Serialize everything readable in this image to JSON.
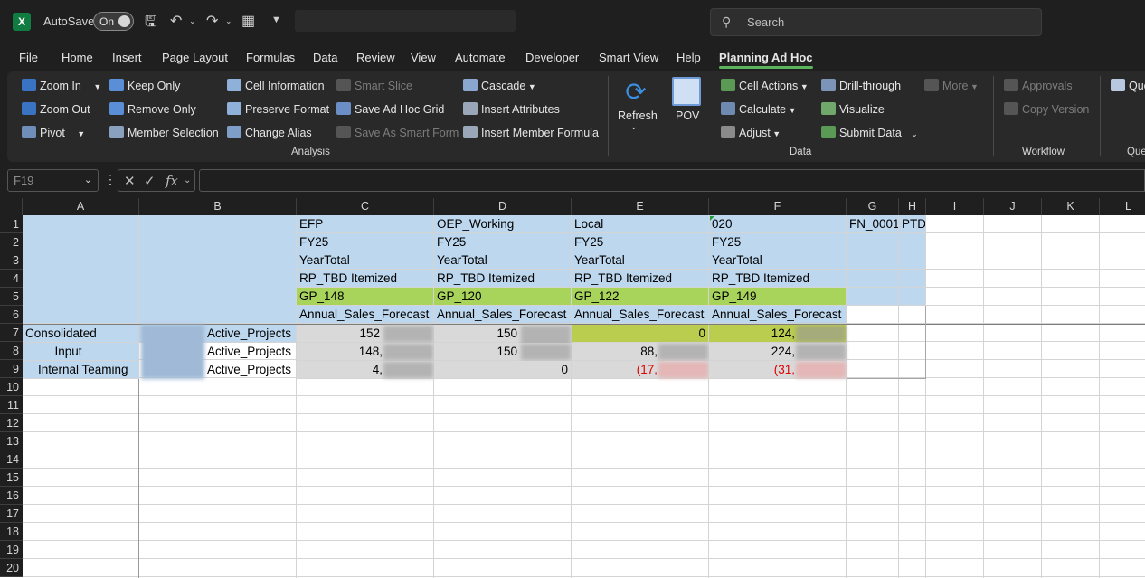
{
  "titlebar": {
    "app_icon": "excel-icon",
    "app_letter": "X",
    "autosave_label": "AutoSave",
    "autosave_state": "On",
    "search_placeholder": "Search"
  },
  "menu": [
    "File",
    "Home",
    "Insert",
    "Page Layout",
    "Formulas",
    "Data",
    "Review",
    "View",
    "Automate",
    "Developer",
    "Smart View",
    "Help",
    "Planning Ad Hoc"
  ],
  "menu_active": "Planning Ad Hoc",
  "ribbon": {
    "analysis": {
      "zoom_in": "Zoom In",
      "zoom_out": "Zoom Out",
      "pivot": "Pivot",
      "keep_only": "Keep Only",
      "remove_only": "Remove Only",
      "member_selection": "Member Selection",
      "cell_information": "Cell Information",
      "preserve_format": "Preserve Format",
      "change_alias": "Change Alias",
      "smart_slice": "Smart Slice",
      "save_ad_hoc_grid": "Save Ad Hoc Grid",
      "save_as_smart_form": "Save As Smart Form",
      "cascade": "Cascade",
      "insert_attributes": "Insert Attributes",
      "insert_member_formula": "Insert Member Formula",
      "label": "Analysis"
    },
    "refresh": "Refresh",
    "pov": "POV",
    "data": {
      "cell_actions": "Cell Actions",
      "calculate": "Calculate",
      "adjust": "Adjust",
      "drill_through": "Drill-through",
      "visualize": "Visualize",
      "submit_data": "Submit Data",
      "more": "More",
      "label": "Data"
    },
    "workflow": {
      "approvals": "Approvals",
      "copy_version": "Copy Version",
      "label": "Workflow"
    },
    "extra": {
      "query_partial": "Que",
      "label_partial": "Que"
    }
  },
  "formula_bar": {
    "name_box": "F19",
    "value": ""
  },
  "sheet": {
    "columns": [
      "A",
      "B",
      "C",
      "D",
      "E",
      "F",
      "G",
      "H",
      "I",
      "J",
      "K",
      "L"
    ],
    "rows": [
      "1",
      "2",
      "3",
      "4",
      "5",
      "6",
      "7",
      "8",
      "9",
      "10",
      "11",
      "12",
      "13",
      "14",
      "15",
      "16",
      "17",
      "18",
      "19",
      "20"
    ],
    "header_rows": [
      [
        "EFP",
        "OEP_Working",
        "Local",
        "020"
      ],
      [
        "FY25",
        "FY25",
        "FY25",
        "FY25"
      ],
      [
        "YearTotal",
        "YearTotal",
        "YearTotal",
        "YearTotal"
      ],
      [
        "RP_TBD Itemized",
        "RP_TBD Itemized",
        "RP_TBD Itemized",
        "RP_TBD Itemized"
      ],
      [
        "GP_148",
        "GP_120",
        "GP_122",
        "GP_149"
      ],
      [
        "Annual_Sales_Forecast",
        "Annual_Sales_Forecast",
        "Annual_Sales_Forecast",
        "Annual_Sales_Forecast"
      ]
    ],
    "g1": "FN_0001",
    "h1": "PTD",
    "data_rows": [
      {
        "a": "Consolidated",
        "b": "Active_Projects",
        "c": "152",
        "d": "150",
        "e": "0",
        "f": "124,"
      },
      {
        "a": "Input",
        "b": "Active_Projects",
        "c": "148,",
        "d": "150",
        "e": "88,",
        "f": "224,"
      },
      {
        "a": "Internal Teaming",
        "b": "Active_Projects",
        "c": "4,",
        "d": "0",
        "e": "(17,",
        "f": "(31,"
      }
    ]
  },
  "colors": {
    "excel_green": "#107c41",
    "header_blue": "#bdd7ee",
    "gp_green": "#a9d45b",
    "negative_red": "#e00000",
    "active_tab_underline": "#5bb35b"
  }
}
